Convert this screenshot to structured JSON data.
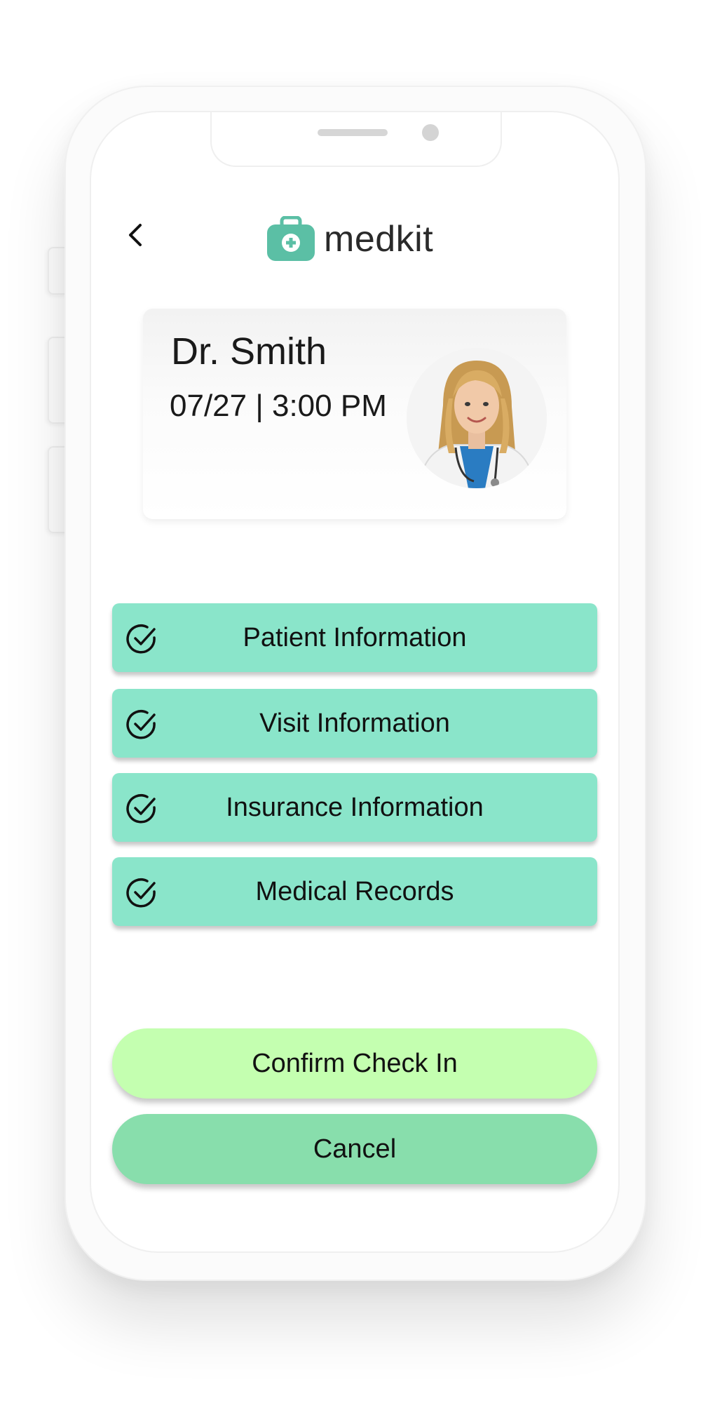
{
  "header": {
    "back_icon": "chevron-left-icon",
    "logo_text": "medkit",
    "logo_icon": "medical-kit-icon"
  },
  "appointment": {
    "doctor_name": "Dr. Smith",
    "datetime": "07/27 | 3:00 PM",
    "avatar": "doctor-avatar"
  },
  "checklist": [
    {
      "label": "Patient Information",
      "icon": "check-circle-icon"
    },
    {
      "label": "Visit Information",
      "icon": "check-circle-icon"
    },
    {
      "label": "Insurance Information",
      "icon": "check-circle-icon"
    },
    {
      "label": "Medical Records",
      "icon": "check-circle-icon"
    }
  ],
  "actions": {
    "confirm_label": "Confirm Check In",
    "cancel_label": "Cancel"
  },
  "colors": {
    "brand": "#5bbfa5",
    "checklist_bg": "#8ae5ca",
    "confirm_bg": "#c4ffb0",
    "cancel_bg": "#88deac"
  }
}
